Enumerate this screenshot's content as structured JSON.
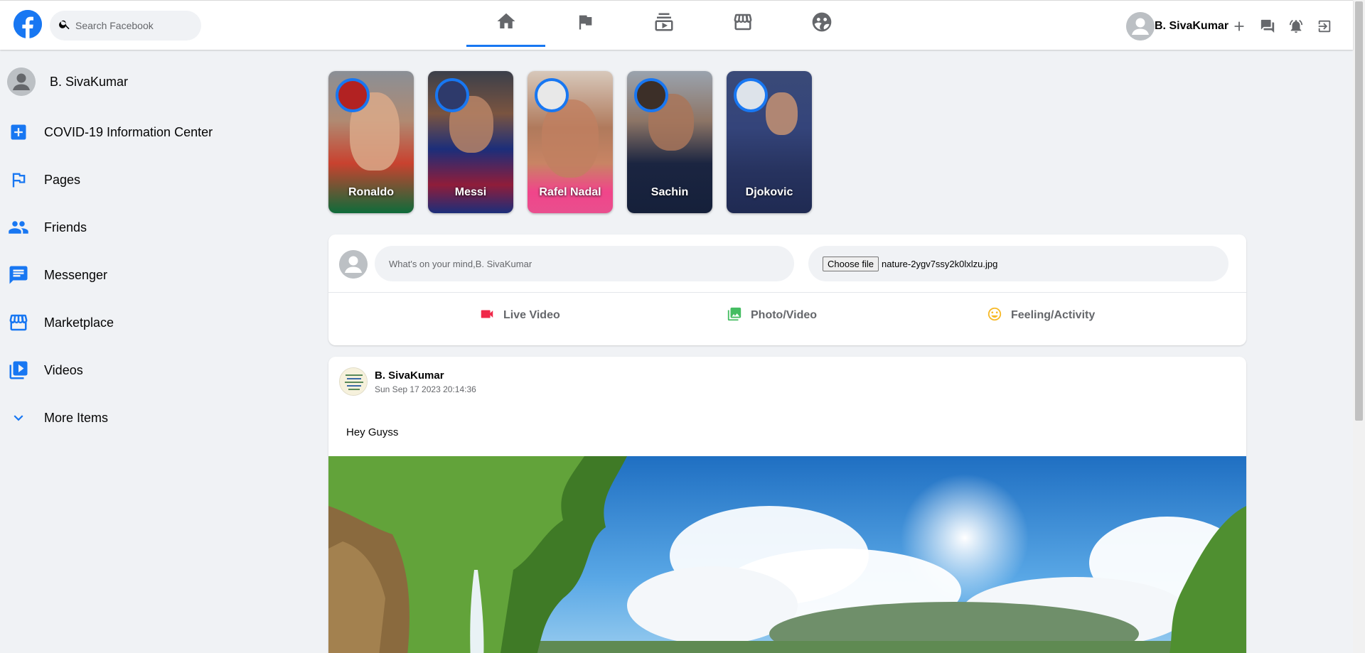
{
  "header": {
    "search_placeholder": "Search Facebook",
    "user_name": "B. SivaKumar",
    "nav_tabs": [
      "home",
      "pages",
      "watch",
      "marketplace",
      "groups"
    ],
    "active_tab": "home"
  },
  "sidebar": {
    "user_name": "B. SivaKumar",
    "items": [
      {
        "label": "COVID-19 Information Center",
        "icon": "plus-box-icon"
      },
      {
        "label": "Pages",
        "icon": "flag-icon"
      },
      {
        "label": "Friends",
        "icon": "people-icon"
      },
      {
        "label": "Messenger",
        "icon": "chat-icon"
      },
      {
        "label": "Marketplace",
        "icon": "storefront-icon"
      },
      {
        "label": "Videos",
        "icon": "video-library-icon"
      },
      {
        "label": "More Items",
        "icon": "chevron-down-icon"
      }
    ]
  },
  "stories": [
    {
      "name": "Ronaldo"
    },
    {
      "name": "Messi"
    },
    {
      "name": "Rafel Nadal"
    },
    {
      "name": "Sachin"
    },
    {
      "name": "Djokovic"
    }
  ],
  "composer": {
    "placeholder": "What's on your mind,B. SivaKumar",
    "file_button": "Choose file",
    "file_name": "nature-2ygv7ssy2k0lxlzu.jpg",
    "options": [
      {
        "label": "Live Video",
        "icon": "videocam-icon"
      },
      {
        "label": "Photo/Video",
        "icon": "photo-library-icon"
      },
      {
        "label": "Feeling/Activity",
        "icon": "smiley-icon"
      }
    ]
  },
  "post": {
    "author": "B. SivaKumar",
    "timestamp": "Sun Sep 17 2023 20:14:36",
    "text": "Hey Guyss"
  },
  "colors": {
    "brand": "#1877f2",
    "background": "#f0f2f5",
    "live_red": "#f02849",
    "photo_green": "#45bd62",
    "feeling_yellow": "#f7b928"
  }
}
